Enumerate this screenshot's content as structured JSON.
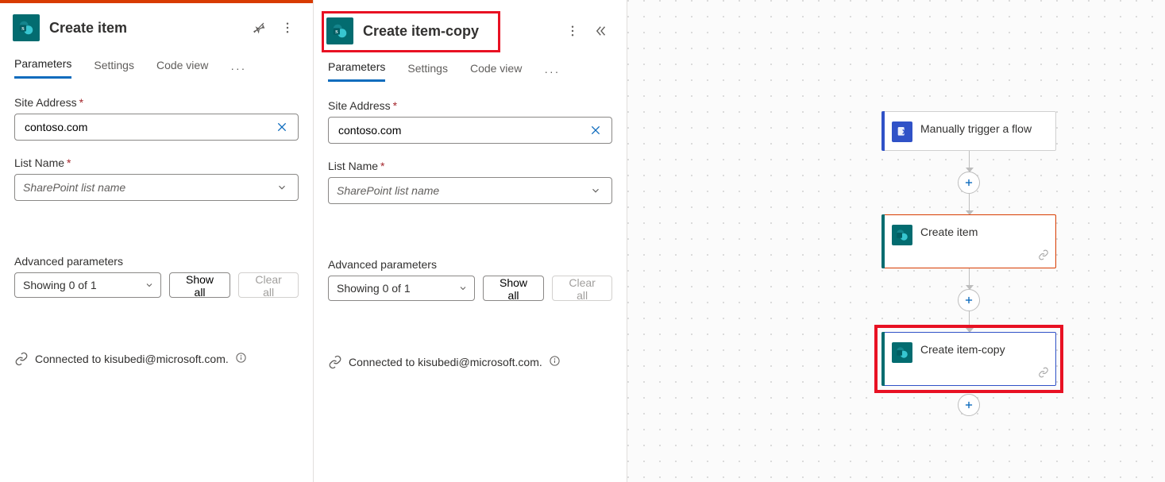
{
  "panel1": {
    "title": "Create item",
    "tabs": {
      "parameters": "Parameters",
      "settings": "Settings",
      "codeview": "Code view"
    },
    "siteAddressLabel": "Site Address",
    "siteAddressValue": "contoso.com",
    "listNameLabel": "List Name",
    "listNamePlaceholder": "SharePoint list name",
    "advLabel": "Advanced parameters",
    "advSelectText": "Showing 0 of 1",
    "showAll": "Show all",
    "clearAll": "Clear all",
    "connectedTo": "Connected to kisubedi@microsoft.com."
  },
  "panel2": {
    "title": "Create item-copy",
    "tabs": {
      "parameters": "Parameters",
      "settings": "Settings",
      "codeview": "Code view"
    },
    "siteAddressLabel": "Site Address",
    "siteAddressValue": "contoso.com",
    "listNameLabel": "List Name",
    "listNamePlaceholder": "SharePoint list name",
    "advLabel": "Advanced parameters",
    "advSelectText": "Showing 0 of 1",
    "showAll": "Show all",
    "clearAll": "Clear all",
    "connectedTo": "Connected to kisubedi@microsoft.com."
  },
  "canvas": {
    "trigger": "Manually trigger a flow",
    "action1": "Create item",
    "action2": "Create item-copy"
  }
}
